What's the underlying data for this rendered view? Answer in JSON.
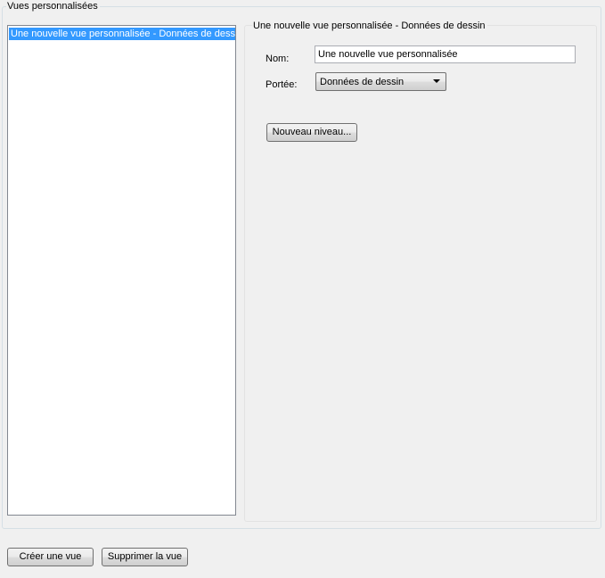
{
  "group": {
    "title": "Vues personnalisées"
  },
  "views_list": {
    "items": [
      "Une nouvelle vue personnalisée - Données de dessin"
    ],
    "selected_index": 0
  },
  "details": {
    "title": "Une nouvelle vue personnalisée - Données de dessin",
    "name_label": "Nom:",
    "name_value": "Une nouvelle vue personnalisée",
    "scope_label": "Portée:",
    "scope_value": "Données de dessin",
    "new_level_label": "Nouveau niveau..."
  },
  "footer": {
    "create_label": "Créer une vue",
    "delete_label": "Supprimer la vue"
  },
  "colors": {
    "selection": "#3399ff",
    "window_background": "#f0f0f0"
  }
}
